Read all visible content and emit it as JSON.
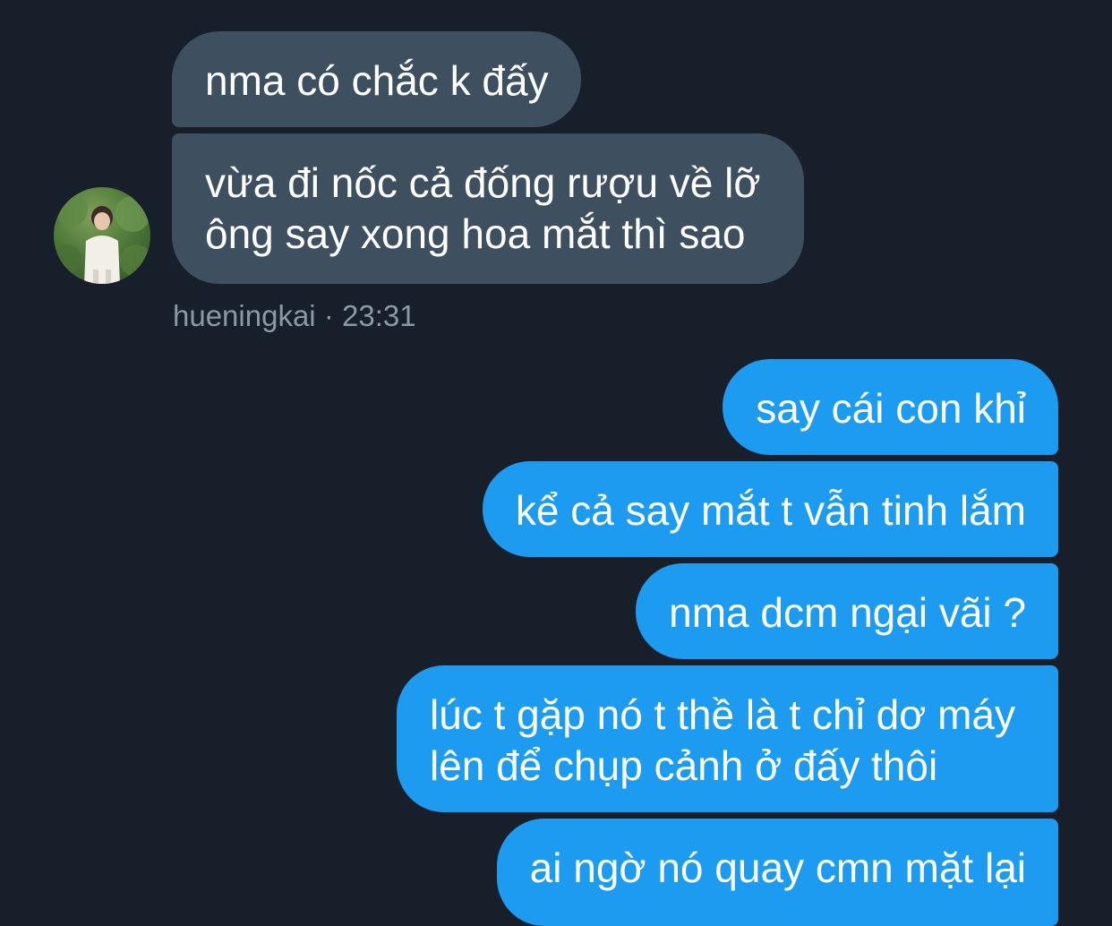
{
  "conversation": {
    "incoming": [
      {
        "text": "nma có chắc k đấy"
      },
      {
        "line1": "vừa đi nốc cả đống rượu về lỡ",
        "line2": "ông say xong hoa mắt thì sao"
      }
    ],
    "sender_name": "hueningkai",
    "separator": "·",
    "timestamp": "23:31",
    "outgoing": [
      {
        "text": "say cái con khỉ"
      },
      {
        "text": "kể cả say mắt t vẫn tinh lắm"
      },
      {
        "text": "nma dcm ngại vãi ?"
      },
      {
        "line1": "lúc t gặp nó t thề là t chỉ dơ máy",
        "line2": "lên để chụp cảnh ở đấy thôi"
      },
      {
        "text": "ai ngờ nó quay cmn mặt lại"
      }
    ]
  },
  "colors": {
    "background": "#17202a",
    "incoming_bubble": "#3e5060",
    "outgoing_bubble": "#1d9bf0",
    "meta_text": "#8b98a5"
  },
  "icons": {
    "avatar": "profile-photo"
  }
}
